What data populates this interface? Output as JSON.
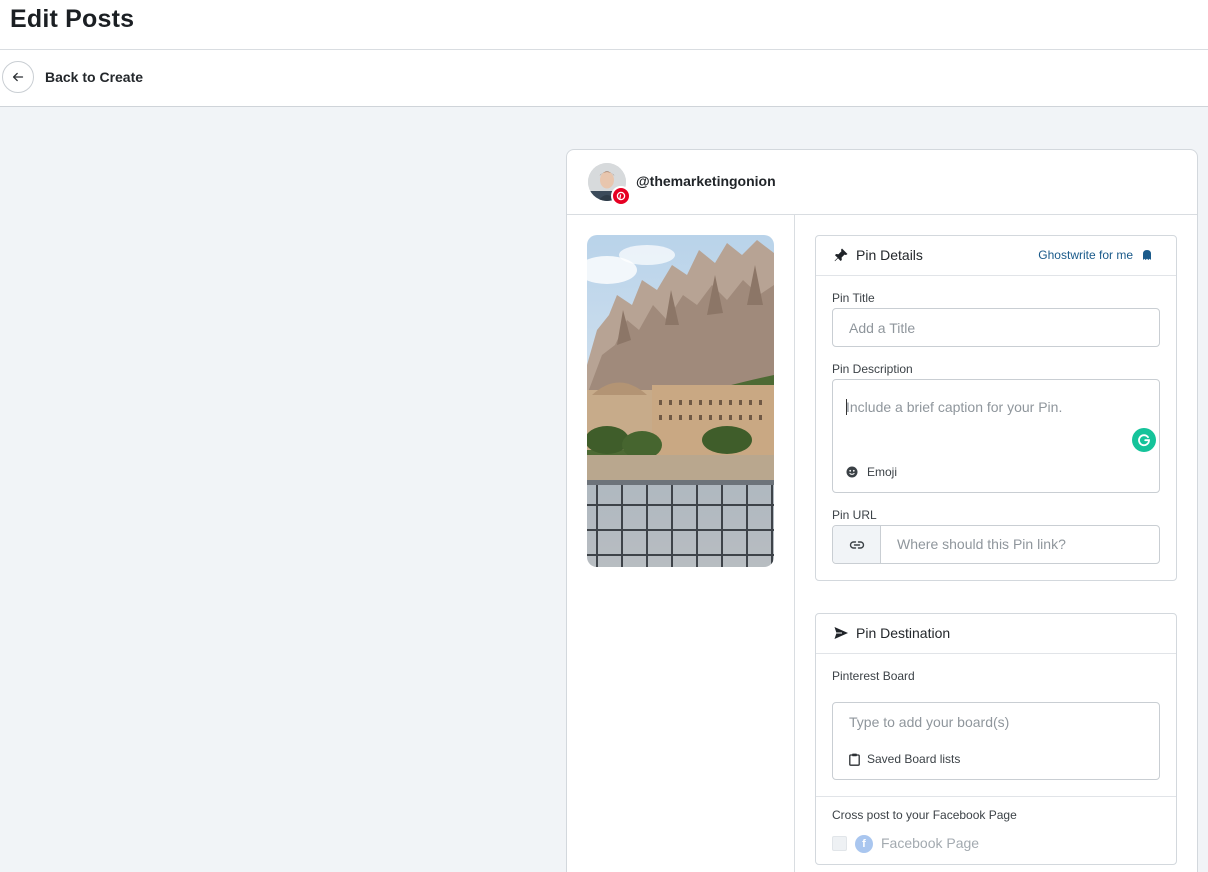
{
  "page": {
    "title": "Edit Posts"
  },
  "nav": {
    "back_label": "Back to Create"
  },
  "account": {
    "handle": "@themarketingonion",
    "network": "pinterest"
  },
  "pin_details": {
    "heading": "Pin Details",
    "ghostwrite_label": "Ghostwrite for me",
    "title_label": "Pin Title",
    "title_placeholder": "Add a Title",
    "title_value": "",
    "description_label": "Pin Description",
    "description_placeholder": "Include a brief caption for your Pin.",
    "description_value": "",
    "emoji_label": "Emoji",
    "url_label": "Pin URL",
    "url_placeholder": "Where should this Pin link?",
    "url_value": ""
  },
  "pin_destination": {
    "heading": "Pin Destination",
    "board_label": "Pinterest Board",
    "board_placeholder": "Type to add your board(s)",
    "saved_lists_label": "Saved Board lists",
    "cross_post_label": "Cross post to your Facebook Page",
    "facebook_page_label": "Facebook Page",
    "facebook_checked": false
  },
  "colors": {
    "pinterest_red": "#e60023",
    "grammarly_green": "#15c39a",
    "link_blue": "#1a5a8a",
    "canvas_bg": "#f1f4f7"
  },
  "icons": {
    "back": "arrow-left-icon",
    "pin": "pushpin-icon",
    "ghostwrite": "ghost-icon",
    "emoji": "smiley-icon",
    "url": "link-icon",
    "destination": "paper-plane-icon",
    "saved_lists": "clipboard-icon",
    "facebook": "facebook-icon",
    "grammarly": "grammarly-icon"
  }
}
